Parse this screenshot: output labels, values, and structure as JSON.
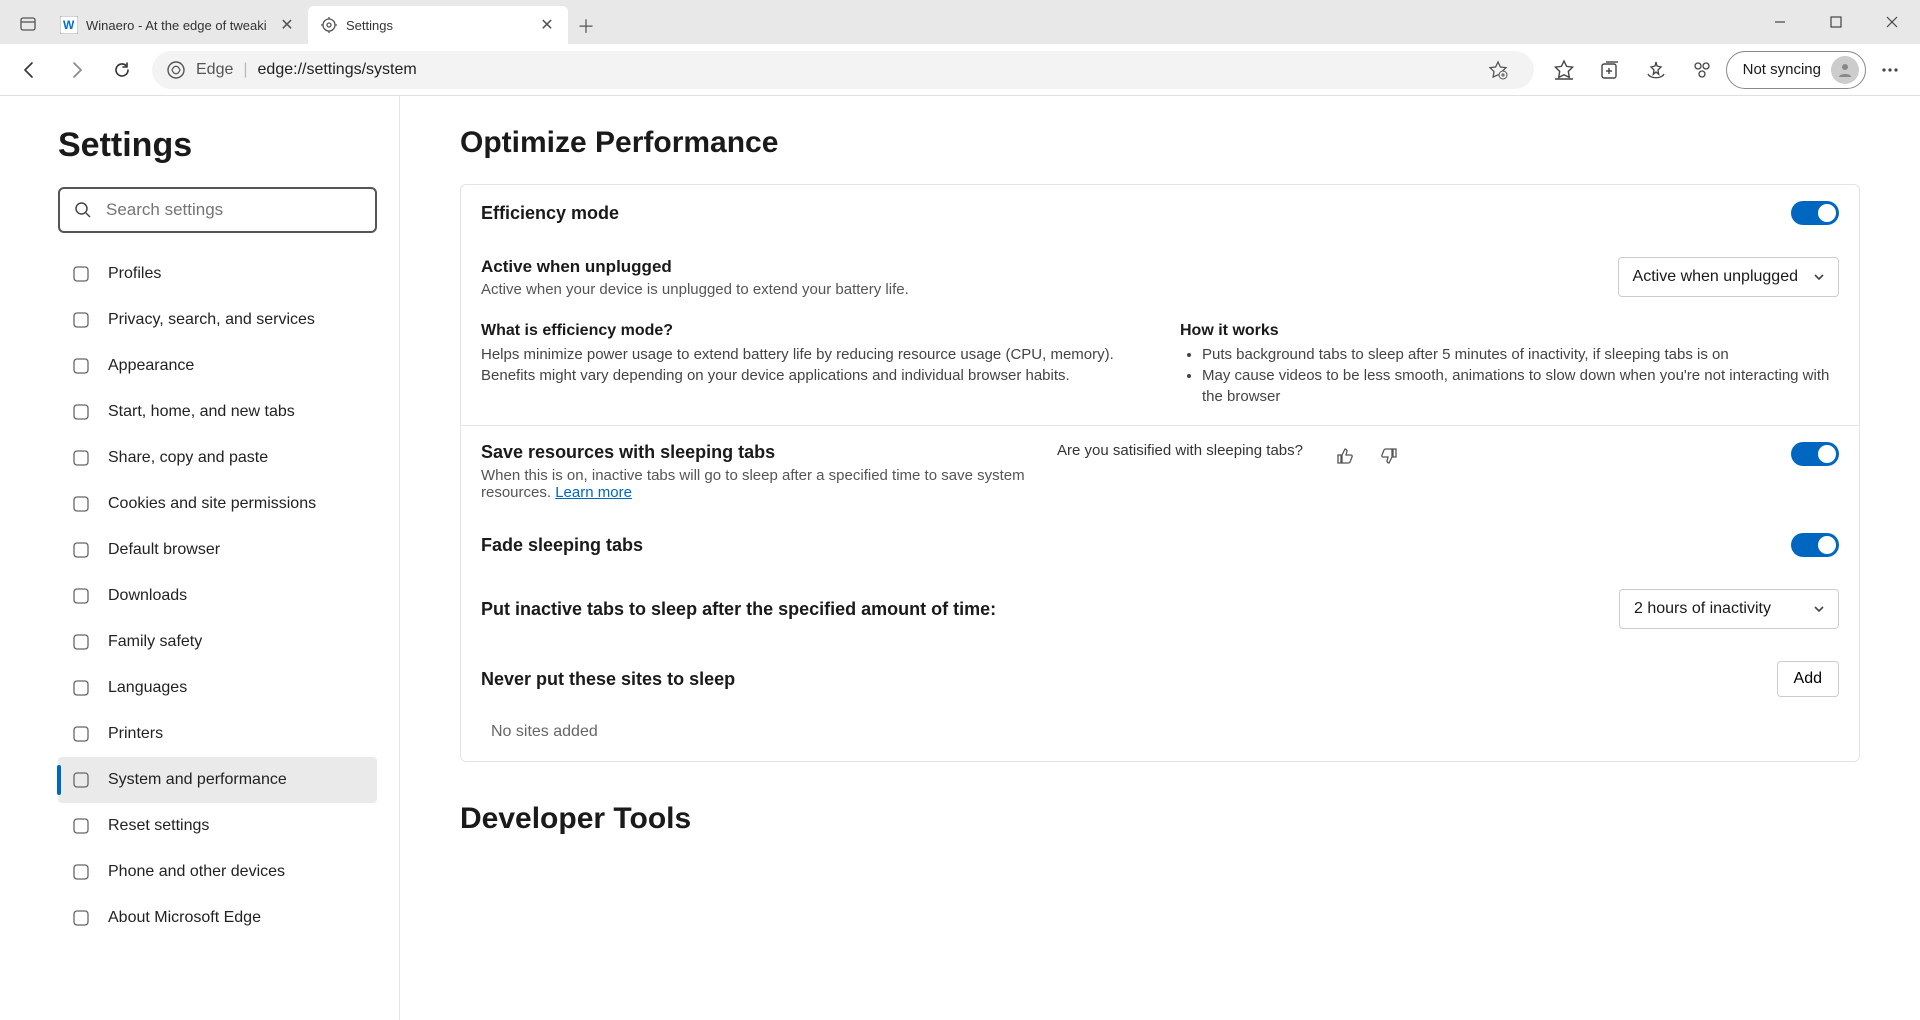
{
  "tabs": [
    {
      "title": "Winaero - At the edge of tweaki"
    },
    {
      "title": "Settings"
    }
  ],
  "address": {
    "scheme": "Edge",
    "url": "edge://settings/system"
  },
  "sync_label": "Not syncing",
  "sidebar": {
    "title": "Settings",
    "search_placeholder": "Search settings",
    "items": [
      "Profiles",
      "Privacy, search, and services",
      "Appearance",
      "Start, home, and new tabs",
      "Share, copy and paste",
      "Cookies and site permissions",
      "Default browser",
      "Downloads",
      "Family safety",
      "Languages",
      "Printers",
      "System and performance",
      "Reset settings",
      "Phone and other devices",
      "About Microsoft Edge"
    ],
    "active_index": 11
  },
  "content": {
    "heading": "Optimize Performance",
    "efficiency": {
      "title": "Efficiency mode",
      "sub_title": "Active when unplugged",
      "sub_desc": "Active when your device is unplugged to extend your battery life.",
      "dropdown": "Active when unplugged",
      "what_title": "What is efficiency mode?",
      "what_desc": "Helps minimize power usage to extend battery life by reducing resource usage (CPU, memory). Benefits might vary depending on your device applications and individual browser habits.",
      "how_title": "How it works",
      "how_b1": "Puts background tabs to sleep after 5 minutes of inactivity, if sleeping tabs is on",
      "how_b2": "May cause videos to be less smooth, animations to slow down when you're not interacting with the browser"
    },
    "sleep": {
      "title": "Save resources with sleeping tabs",
      "desc_pre": "When this is on, inactive tabs will go to sleep after a specified time to save system resources. ",
      "learn_more": "Learn more",
      "feedback_q": "Are you satisified with sleeping tabs?"
    },
    "fade": {
      "title": "Fade sleeping tabs"
    },
    "timeout": {
      "title": "Put inactive tabs to sleep after the specified amount of time:",
      "value": "2 hours of inactivity"
    },
    "never": {
      "title": "Never put these sites to sleep",
      "add": "Add",
      "empty": "No sites added"
    },
    "dev_heading": "Developer Tools"
  }
}
